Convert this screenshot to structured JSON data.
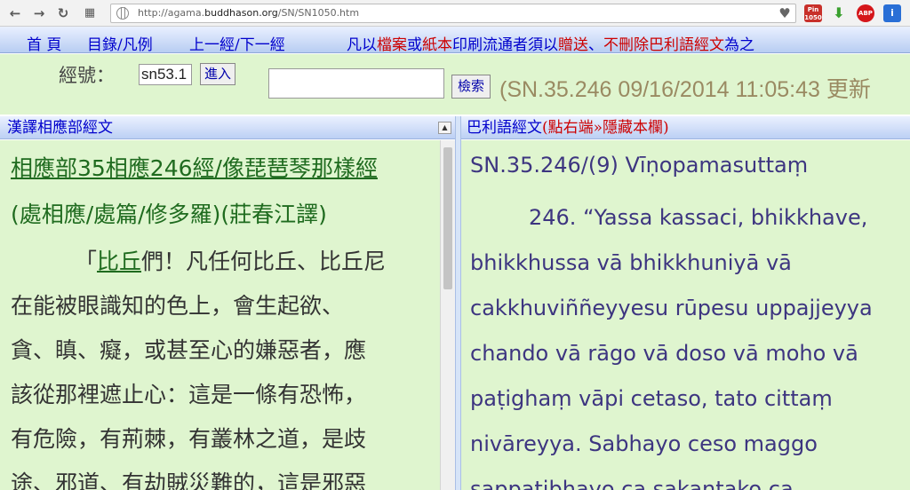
{
  "browser": {
    "url_prefix": "http://agama.",
    "url_domain": "buddhason.org",
    "url_path": "/SN/SN1050.htm",
    "extensions": [
      "Pin 1050",
      "download",
      "ABP",
      "i"
    ]
  },
  "sitebar": {
    "home": "首 頁",
    "contents": "目錄/凡例",
    "prevnext": "上一經/下一經",
    "notice_parts": [
      {
        "text": "凡以",
        "color": "blue"
      },
      {
        "text": "檔案",
        "color": "red"
      },
      {
        "text": "或",
        "color": "blue"
      },
      {
        "text": "紙本",
        "color": "red"
      },
      {
        "text": "印刷流通者須以",
        "color": "blue"
      },
      {
        "text": "贈送",
        "color": "red"
      },
      {
        "text": "、",
        "color": "blue"
      },
      {
        "text": "不刪除巴利語經文",
        "color": "red"
      },
      {
        "text": "為之",
        "color": "blue"
      }
    ]
  },
  "search": {
    "sutta_label": "經號：",
    "sutta_value": "sn53.1",
    "go_label": "進入",
    "search_value": "",
    "search_button": "檢索",
    "update_info": "(SN.35.246 09/16/2014 11:05:43 更新"
  },
  "left_header": "漢譯相應部經文",
  "right_header": {
    "part1": "巴利語經文",
    "part2": "(點右端»隱藏本欄)"
  },
  "chinese": {
    "title": "相應部35相應246經/像琵琶琴那樣經",
    "subtitle": "(處相應/處篇/修多羅)(莊春江譯)",
    "first_quote": "「",
    "first_link": "比丘",
    "first_rest": "們！凡任何比丘、比丘尼",
    "lines": [
      "在能被眼識知的色上，會生起欲、",
      "貪、瞋、癡，或甚至心的嫌惡者，應",
      "該從那裡遮止心：這是一條有恐怖，",
      "有危險，有荊棘，有叢林之道，是歧",
      "途、邪道、有劫賊災難的，這是邪惡"
    ]
  },
  "pali": {
    "title": "SN.35.246/(9) Vīṇopamasuttaṃ",
    "lines": [
      "246. “Yassa kassaci, bhikkhave,",
      "bhikkhussa vā bhikkhuniyā vā",
      "cakkhuviññeyyesu rūpesu uppajjeyya",
      "chando vā rāgo vā doso vā moho vā",
      "paṭighaṃ vāpi cetaso, tato cittaṃ",
      "nivāreyya. Sabhayo ceso maggo",
      "sappaṭibhayo ca sakaṇṭako ca"
    ]
  },
  "colors": {
    "page_bg": "#dff5cf",
    "menu_blue": "#0000cc",
    "notice_red": "#cc0000",
    "chinese_link": "#1f6b1f",
    "pali_text": "#3d3580",
    "update_text": "#9a8a62"
  }
}
